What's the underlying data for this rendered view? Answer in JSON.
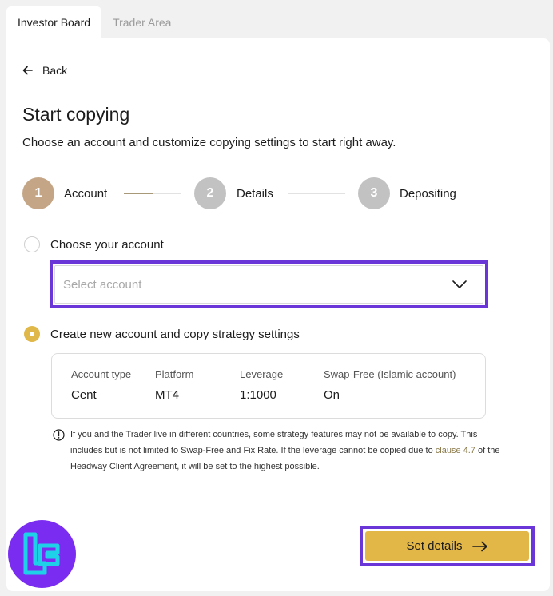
{
  "tabs": [
    {
      "label": "Investor Board",
      "active": true
    },
    {
      "label": "Trader Area",
      "active": false
    }
  ],
  "back_label": "Back",
  "title": "Start copying",
  "subtitle": "Choose an account and customize copying settings to start right away.",
  "steps": [
    {
      "number": "1",
      "label": "Account",
      "color": "#c4a686"
    },
    {
      "number": "2",
      "label": "Details",
      "color": "#c2c2c2"
    },
    {
      "number": "3",
      "label": "Depositing",
      "color": "#c2c2c2"
    }
  ],
  "options": {
    "choose": {
      "label": "Choose your account",
      "checked": false
    },
    "select_placeholder": "Select account",
    "create": {
      "label": "Create new account and copy strategy settings",
      "checked": true
    }
  },
  "details": [
    {
      "header": "Account type",
      "value": "Cent"
    },
    {
      "header": "Platform",
      "value": "MT4"
    },
    {
      "header": "Leverage",
      "value": "1:1000"
    },
    {
      "header": "Swap-Free (Islamic account)",
      "value": "On"
    }
  ],
  "note": {
    "before": "If you and the Trader live in different countries, some strategy features may not be available to copy. This includes but is not limited to Swap-Free and Fix Rate. If the leverage cannot be copied due to ",
    "link": "clause 4.7",
    "after": " of the Headway Client Agreement, it will be set to the highest possible."
  },
  "cta_label": "Set details",
  "colors": {
    "accent": "#e3b648",
    "highlight": "#6a36d8",
    "logo_bg": "#7a2df0",
    "logo_fg": "#1fd1e8"
  }
}
